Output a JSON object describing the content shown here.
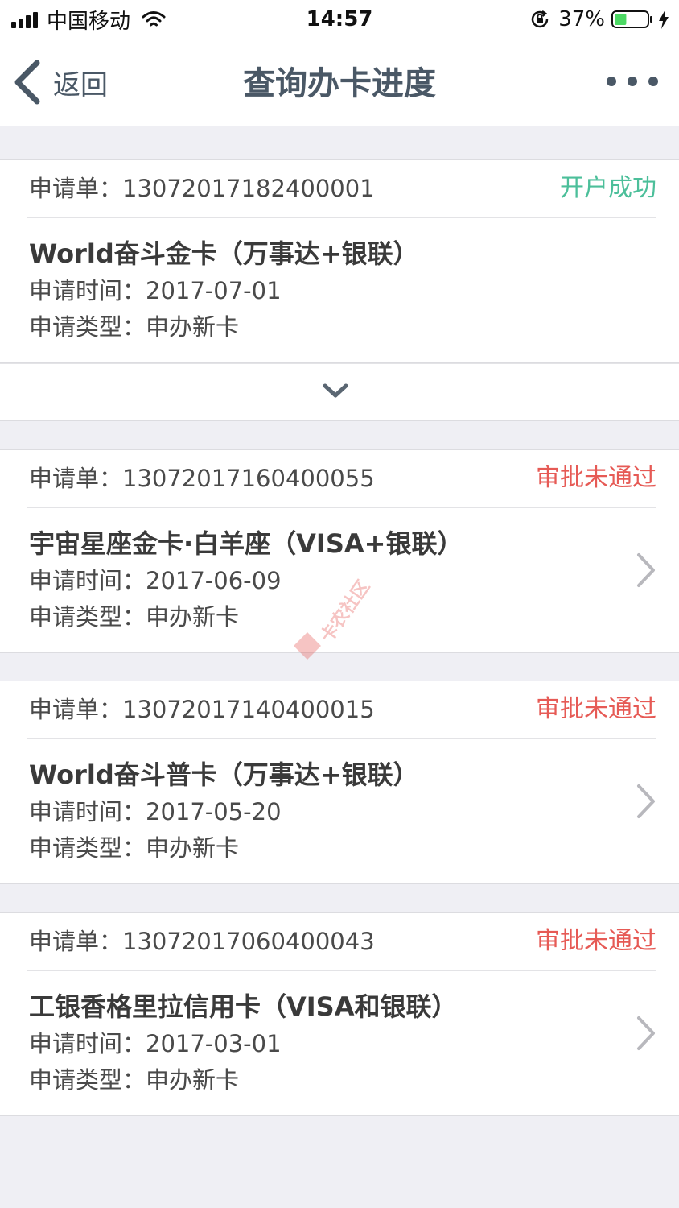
{
  "status_bar": {
    "carrier": "中国移动",
    "time": "14:57",
    "battery_percent": "37%",
    "battery_level": 0.37,
    "battery_color": "#4cd964"
  },
  "nav": {
    "back_label": "返回",
    "title": "查询办卡进度",
    "more_icon": "more-dots-icon"
  },
  "applications": [
    {
      "order_label": "申请单：13072017182400001",
      "status": "开户成功",
      "status_type": "success",
      "card_name": "World奋斗金卡（万事达+银联）",
      "apply_time": "申请时间：2017-07-01",
      "apply_type": "申请类型：申办新卡"
    },
    {
      "order_label": "申请单：13072017160400055",
      "status": "审批未通过",
      "status_type": "fail",
      "card_name": "宇宙星座金卡·白羊座（VISA+银联）",
      "apply_time": "申请时间：2017-06-09",
      "apply_type": "申请类型：申办新卡"
    },
    {
      "order_label": "申请单：13072017140400015",
      "status": "审批未通过",
      "status_type": "fail",
      "card_name": "World奋斗普卡（万事达+银联）",
      "apply_time": "申请时间：2017-05-20",
      "apply_type": "申请类型：申办新卡"
    },
    {
      "order_label": "申请单：13072017060400043",
      "status": "审批未通过",
      "status_type": "fail",
      "card_name": "工银香格里拉信用卡（VISA和银联）",
      "apply_time": "申请时间：2017-03-01",
      "apply_type": "申请类型：申办新卡"
    }
  ],
  "colors": {
    "success": "#4cbf9a",
    "fail": "#e65a55",
    "nav_text": "#4a5866",
    "background": "#efeff4"
  },
  "watermark_text": "卡农社区"
}
